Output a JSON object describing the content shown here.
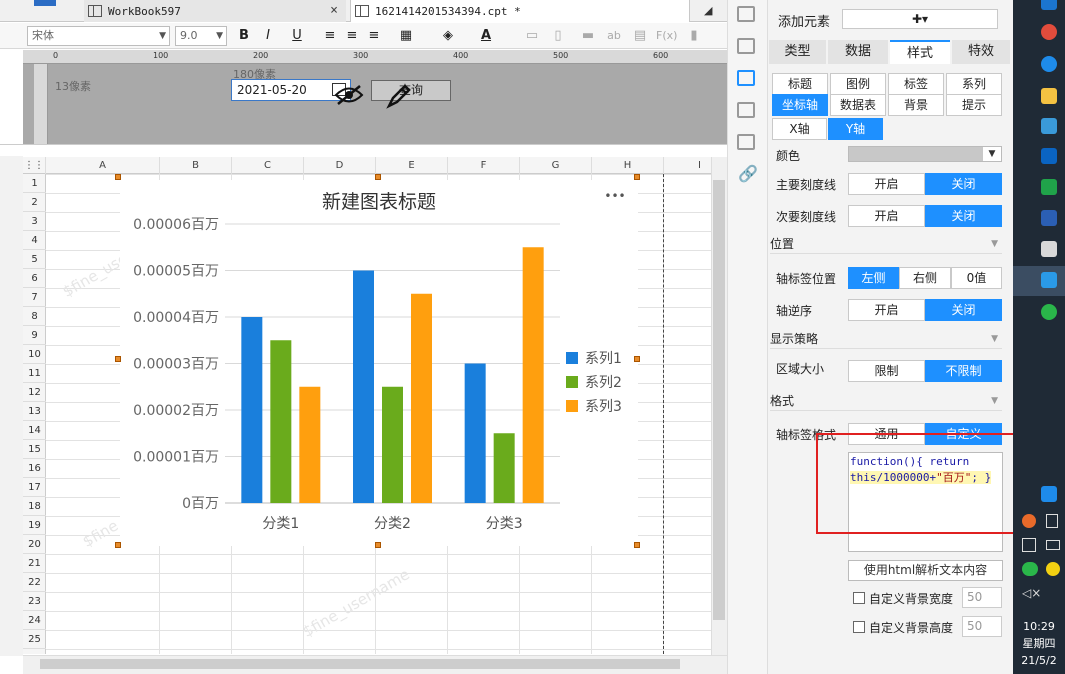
{
  "tabs": [
    {
      "label": "WorkBook597"
    },
    {
      "label": "1621414201534394.cpt *"
    }
  ],
  "toolbar": {
    "font": "宋体",
    "size": "9.0",
    "bold": "B",
    "italic": "I",
    "underline": "U"
  },
  "ruler": {
    "marks": [
      "0",
      "100",
      "200",
      "300",
      "400",
      "500",
      "600"
    ]
  },
  "params": {
    "left_label": "13像素",
    "top_label": "180像素",
    "date_value": "2021-05-20",
    "query_label": "查询"
  },
  "grid": {
    "columns": [
      "A",
      "B",
      "C",
      "D",
      "E",
      "F",
      "G",
      "H",
      "I"
    ],
    "rows": [
      "1",
      "2",
      "3",
      "4",
      "5",
      "6",
      "7",
      "8",
      "9",
      "10",
      "11",
      "12",
      "13",
      "14",
      "15",
      "16",
      "17",
      "18",
      "19",
      "20",
      "21",
      "22",
      "23",
      "24",
      "25"
    ],
    "watermark": "$fine_username"
  },
  "chart_data": {
    "type": "bar",
    "title": "新建图表标题",
    "categories": [
      "分类1",
      "分类2",
      "分类3"
    ],
    "series": [
      {
        "name": "系列1",
        "values": [
          4e-05,
          5e-05,
          3e-05
        ],
        "color": "#1a7fdc"
      },
      {
        "name": "系列2",
        "values": [
          3.5e-05,
          2.5e-05,
          1.5e-05
        ],
        "color": "#6aab1c"
      },
      {
        "name": "系列3",
        "values": [
          2.5e-05,
          4.5e-05,
          5.5e-05
        ],
        "color": "#ff9f0e"
      }
    ],
    "yticks": [
      "0百万",
      "0.00001百万",
      "0.00002百万",
      "0.00003百万",
      "0.00004百万",
      "0.00005百万",
      "0.00006百万"
    ],
    "ylim": [
      0,
      6e-05
    ],
    "legend": "right",
    "grid": true,
    "more": "•••"
  },
  "panel": {
    "add_element": "添加元素",
    "add_symbol": "✚▾",
    "top_tabs": [
      "类型",
      "数据",
      "样式",
      "特效"
    ],
    "sub_tabs_row1": [
      "标题",
      "图例",
      "标签",
      "系列"
    ],
    "sub_tabs_row2": [
      "坐标轴",
      "数据表",
      "背景",
      "提示"
    ],
    "axis_tabs": [
      "X轴",
      "Y轴"
    ],
    "color_label": "颜色",
    "major_tick_label": "主要刻度线",
    "minor_tick_label": "次要刻度线",
    "on": "开启",
    "off": "关闭",
    "position_section": "位置",
    "label_pos_label": "轴标签位置",
    "label_pos_opts": [
      "左侧",
      "右侧",
      "0值"
    ],
    "reverse_label": "轴逆序",
    "display_section": "显示策略",
    "area_label": "区域大小",
    "area_opts": [
      "限制",
      "不限制"
    ],
    "format_section": "格式",
    "label_format_label": "轴标签格式",
    "format_opts": [
      "通用",
      "自定义"
    ],
    "code_line1": "function(){ return",
    "code_line2_a": "this/1000000+",
    "code_line2_str": "\"百万\"",
    "code_line2_b": "; }",
    "html_btn": "使用html解析文本内容",
    "bg_width_label": "自定义背景宽度",
    "bg_height_label": "自定义背景高度",
    "bg_width": "50",
    "bg_height": "50"
  },
  "taskbar": {
    "time": "10:29",
    "day": "星期四",
    "date": "21/5/2"
  }
}
